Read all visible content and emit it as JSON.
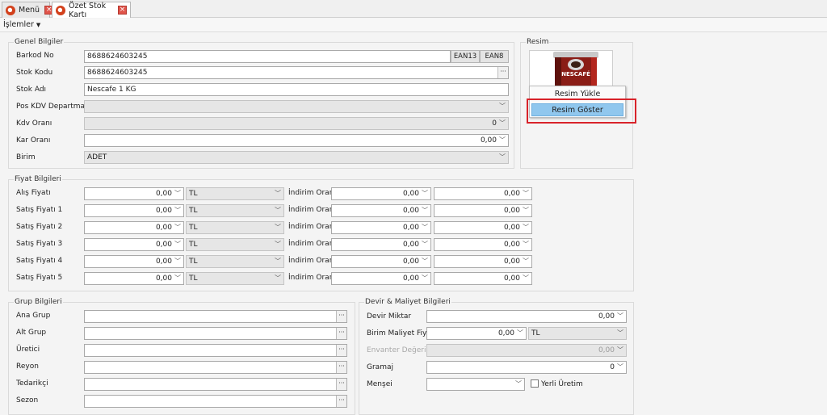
{
  "tabs": [
    {
      "label": "Menü"
    },
    {
      "label": "Özet Stok Kartı"
    }
  ],
  "menubar": {
    "islemler": "İşlemler"
  },
  "genel": {
    "title": "Genel Bilgiler",
    "barkod_label": "Barkod No",
    "barkod_value": "8688624603245",
    "ean13": "EAN13",
    "ean8": "EAN8",
    "stok_kodu_label": "Stok Kodu",
    "stok_kodu_value": "8688624603245",
    "stok_adi_label": "Stok Adı",
    "stok_adi_value": "Nescafe 1 KG",
    "pos_label": "Pos KDV Departman",
    "pos_value": "",
    "kdv_label": "Kdv Oranı",
    "kdv_value": "0",
    "kar_label": "Kar Oranı",
    "kar_value": "0,00",
    "birim_label": "Birim",
    "birim_value": "ADET"
  },
  "resim": {
    "title": "Resim",
    "product_text": "NESCAFÉ",
    "menu": {
      "yukle": "Resim Yükle",
      "goster": "Resim Göster"
    }
  },
  "fiyat": {
    "title": "Fiyat Bilgileri",
    "indirim_label": "İndirim Oranı",
    "rows": [
      {
        "label": "Alış Fiyatı",
        "price": "0,00",
        "currency": "TL",
        "discount": "0,00",
        "discount2": "0,00"
      },
      {
        "label": "Satış Fiyatı 1",
        "price": "0,00",
        "currency": "TL",
        "discount": "0,00",
        "discount2": "0,00"
      },
      {
        "label": "Satış Fiyatı 2",
        "price": "0,00",
        "currency": "TL",
        "discount": "0,00",
        "discount2": "0,00"
      },
      {
        "label": "Satış Fiyatı 3",
        "price": "0,00",
        "currency": "TL",
        "discount": "0,00",
        "discount2": "0,00"
      },
      {
        "label": "Satış Fiyatı 4",
        "price": "0,00",
        "currency": "TL",
        "discount": "0,00",
        "discount2": "0,00"
      },
      {
        "label": "Satış Fiyatı 5",
        "price": "0,00",
        "currency": "TL",
        "discount": "0,00",
        "discount2": "0,00"
      }
    ]
  },
  "grup": {
    "title": "Grup Bilgileri",
    "rows": [
      {
        "label": "Ana Grup",
        "value": ""
      },
      {
        "label": "Alt Grup",
        "value": ""
      },
      {
        "label": "Üretici",
        "value": ""
      },
      {
        "label": "Reyon",
        "value": ""
      },
      {
        "label": "Tedarikçi",
        "value": ""
      },
      {
        "label": "Sezon",
        "value": ""
      }
    ]
  },
  "devir": {
    "title": "Devir & Maliyet Bilgileri",
    "devir_miktar_label": "Devir Miktar",
    "devir_miktar_value": "0,00",
    "birim_maliyet_label": "Birim Maliyet Fiyatı",
    "birim_maliyet_value": "0,00",
    "birim_maliyet_currency": "TL",
    "envanter_label": "Envanter Değeri",
    "envanter_value": "0,00",
    "gramaj_label": "Gramaj",
    "gramaj_value": "0",
    "mensei_label": "Menşei",
    "mensei_value": "",
    "yerli_label": "Yerli Üretim"
  },
  "colors": {
    "highlight": "#90c7ee",
    "annotation_red": "#d8232a"
  }
}
